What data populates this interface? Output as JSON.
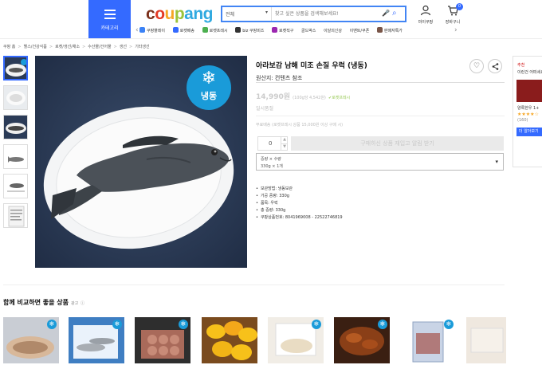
{
  "header": {
    "category_button_label": "카테고리",
    "logo_parts": [
      "c",
      "o",
      "u",
      "p",
      "ang"
    ],
    "search": {
      "category_value": "전체",
      "placeholder": "찾고 싶은 상품을 검색해보세요!"
    },
    "icons": {
      "mypage_label": "마이쿠팡",
      "cart_label": "장바구니",
      "cart_count": "0"
    },
    "quick_menu": [
      {
        "label": "쿠팡플레이",
        "color": "#3b82f6"
      },
      {
        "label": "로켓배송",
        "color": "#346aff"
      },
      {
        "label": "로켓프레시",
        "color": "#4caf50"
      },
      {
        "label": "biz 쿠팡비즈",
        "color": "#333333"
      },
      {
        "label": "로켓직구",
        "color": "#9c27b0"
      },
      {
        "label": "골드박스",
        "color": "#f6a623"
      },
      {
        "label": "이달의신상",
        "color": "#e91e63"
      },
      {
        "label": "이벤트/쿠폰",
        "color": "#ff9800"
      },
      {
        "label": "판매자특가",
        "color": "#795548"
      }
    ]
  },
  "breadcrumb": [
    "쿠팡 홈",
    "헬스/건강식품",
    "로켓/생선/채소",
    "수산물/건어물",
    "생선",
    "기타생선"
  ],
  "product": {
    "title": "아라보감 남해 미조 손질 우럭 (냉동)",
    "origin": "원산지: 컨텐츠 참조",
    "price": "14,990원",
    "unit_price": "(100g당 4,542원)",
    "rocket_label": "로켓프레시",
    "soldout": "일시품절",
    "shipping": "무료배송 (로켓프레시 상품 15,000원 이상 구매 시)",
    "quantity": "0",
    "cta_label": "구매하신 상품 재입고 알림 받기",
    "option_line1": "중량 × 수량",
    "option_line2": "330g × 1개",
    "frozen_label": "냉동",
    "description": [
      "보관방법: 냉동보관",
      "가공 중량: 330g",
      "품목: 우럭",
      "총 중량: 330g",
      "쿠팡상품번호: 8041969008 - 22522746819"
    ]
  },
  "side_reco": {
    "heading": "추천",
    "title": "이런건 어떠세요",
    "product_name": "양록한우 1+",
    "stars": "★★★★☆",
    "count": "(160)",
    "more_label": "더 알아보기"
  },
  "compare": {
    "title": "함께 비교하면 좋을 상품",
    "ad_label": "광고"
  }
}
